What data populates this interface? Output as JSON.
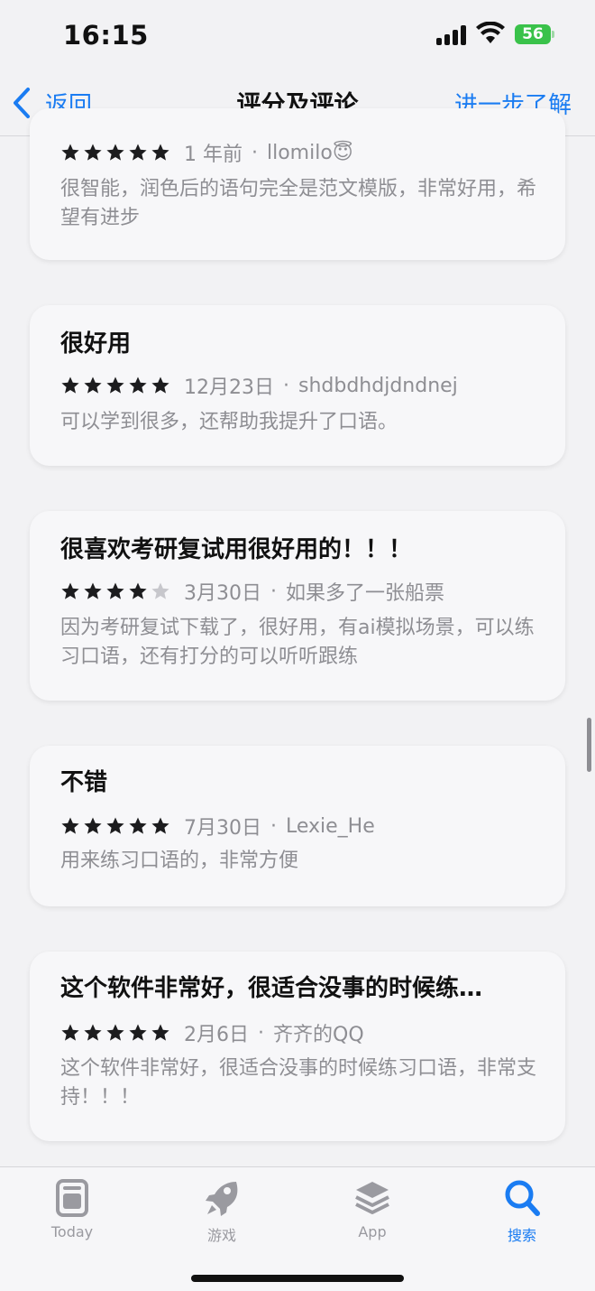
{
  "status_bar": {
    "time": "16:15",
    "battery": "56"
  },
  "nav": {
    "back_label": "返回",
    "title": "评分及评论",
    "more_label": "进一步了解"
  },
  "reviews": [
    {
      "title": "",
      "stars": 5,
      "date": "1 年前",
      "author": "llomilo😇",
      "body": "很智能，润色后的语句完全是范文模版，非常好用，希望有进步"
    },
    {
      "title": "很好用",
      "stars": 5,
      "date": "12月23日",
      "author": "shdbdhdjdndnej",
      "body": "可以学到很多，还帮助我提升了口语。"
    },
    {
      "title": "很喜欢考研复试用很好用的！！！",
      "stars": 4,
      "date": "3月30日",
      "author": "如果多了一张船票",
      "body": "因为考研复试下载了，很好用，有ai模拟场景，可以练习口语，还有打分的可以听听跟练"
    },
    {
      "title": "不错",
      "stars": 5,
      "date": "7月30日",
      "author": "Lexie_He",
      "body": "用来练习口语的，非常方便"
    },
    {
      "title": "这个软件非常好，很适合没事的时候练…",
      "stars": 5,
      "date": "2月6日",
      "author": "齐齐的QQ",
      "body": "这个软件非常好，很适合没事的时候练习口语，非常支持！！！"
    }
  ],
  "meta_separator": "·",
  "tabs": [
    {
      "label": "Today",
      "icon": "today-icon",
      "active": false
    },
    {
      "label": "游戏",
      "icon": "rocket-icon",
      "active": false
    },
    {
      "label": "App",
      "icon": "layers-icon",
      "active": false
    },
    {
      "label": "搜索",
      "icon": "search-icon",
      "active": true
    }
  ],
  "colors": {
    "accent": "#1a7cf2",
    "star": "#1c1c1e",
    "star_empty": "#c7c7cc",
    "battery": "#3ac24a"
  }
}
